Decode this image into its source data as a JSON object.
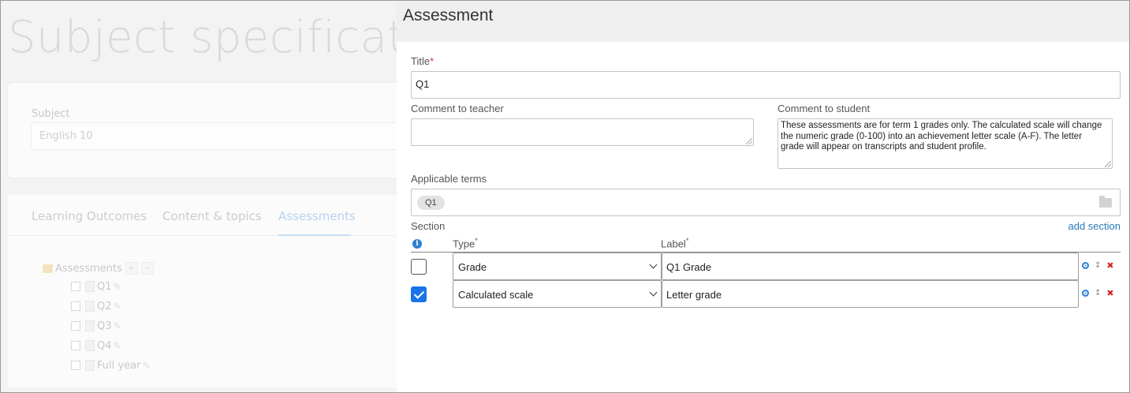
{
  "background": {
    "page_title": "Subject specification",
    "subject_label": "Subject",
    "subject_value": "English 10",
    "tabs": [
      "Learning Outcomes",
      "Content & topics",
      "Assessments"
    ],
    "tree_root": "Assessments",
    "tree_items": [
      "Q1",
      "Q2",
      "Q3",
      "Q4",
      "Full year"
    ]
  },
  "dialog": {
    "title": "Assessment",
    "title_field": {
      "label": "Title",
      "required_mark": "*",
      "value": "Q1"
    },
    "comment_teacher": {
      "label": "Comment to teacher",
      "value": ""
    },
    "comment_student": {
      "label": "Comment to student",
      "value": "These assessments are for term 1 grades only. The calculated scale will change the numeric grade (0-100) into an achievement letter scale (A-F). The letter grade will appear on transcripts and student profile."
    },
    "applicable_terms": {
      "label": "Applicable terms",
      "chips": [
        "Q1"
      ]
    },
    "section": {
      "label": "Section",
      "add_link": "add section",
      "type_header": "Type",
      "label_header": "Label",
      "required_mark": "*",
      "rows": [
        {
          "checked": false,
          "type": "Grade",
          "label": "Q1 Grade"
        },
        {
          "checked": true,
          "type": "Calculated scale",
          "label": "Letter grade"
        }
      ]
    }
  },
  "icons": {
    "info": "info-icon",
    "settings": "gear-icon",
    "move": "move-icon",
    "delete": "delete-icon",
    "terms_browse": "folder-icon"
  },
  "colors": {
    "accent_blue": "#2f7fd3",
    "checkbox_blue": "#1a73e8",
    "required_red": "#d9363e",
    "delete_red": "#d62828",
    "header_gray": "#efefef"
  }
}
